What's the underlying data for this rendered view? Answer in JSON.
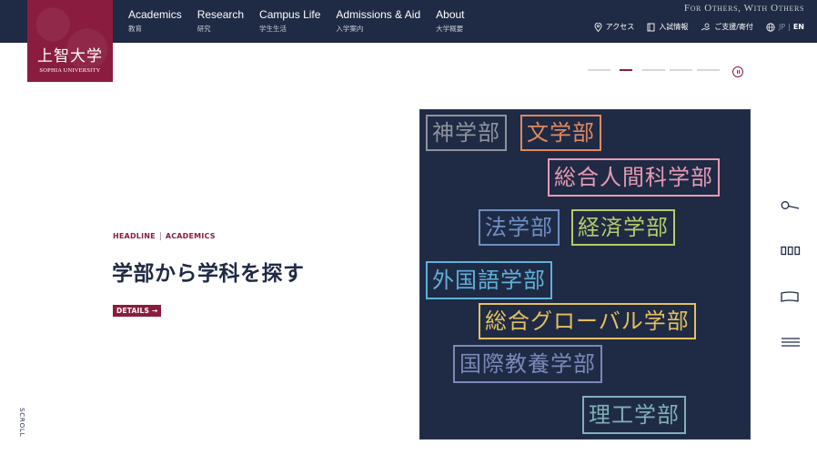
{
  "logo": {
    "jp": "上智大学",
    "en": "SOPHIA UNIVERSITY"
  },
  "nav": [
    {
      "en": "Academics",
      "jp": "教育"
    },
    {
      "en": "Research",
      "jp": "研究"
    },
    {
      "en": "Campus Life",
      "jp": "学生生活"
    },
    {
      "en": "Admissions & Aid",
      "jp": "入学案内"
    },
    {
      "en": "About",
      "jp": "大学概要"
    }
  ],
  "motto": "For Others, With Others",
  "utility": {
    "access": "アクセス",
    "admissions": "入試情報",
    "support": "ご支援/寄付"
  },
  "lang": {
    "jp": "JP",
    "sep": "|",
    "en": "EN"
  },
  "slider": {
    "slide_count": 5,
    "active_index": 1
  },
  "hero": {
    "kicker_left": "HEADLINE",
    "kicker_right": "ACADEMICS",
    "headline": "学部から学科を探す",
    "details": "DETAILS →"
  },
  "scroll_label": "SCROLL",
  "faculties": [
    {
      "name": "神学部",
      "color": "#8e939d"
    },
    {
      "name": "文学部",
      "color": "#e0895f"
    },
    {
      "name": "総合人間科学部",
      "color": "#e79ab4"
    },
    {
      "name": "法学部",
      "color": "#6f8fc2"
    },
    {
      "name": "経済学部",
      "color": "#b7cc66"
    },
    {
      "name": "外国語学部",
      "color": "#5fb1d9"
    },
    {
      "name": "総合グローバル学部",
      "color": "#e2c062"
    },
    {
      "name": "国際教養学部",
      "color": "#7b88b8"
    },
    {
      "name": "理工学部",
      "color": "#7fb0b8"
    }
  ],
  "rail_icons": [
    "search-icon",
    "grid-icon",
    "flag-icon",
    "menu-icon"
  ],
  "colors": {
    "navy": "#1f2a44",
    "crimson": "#8a1d3f"
  }
}
